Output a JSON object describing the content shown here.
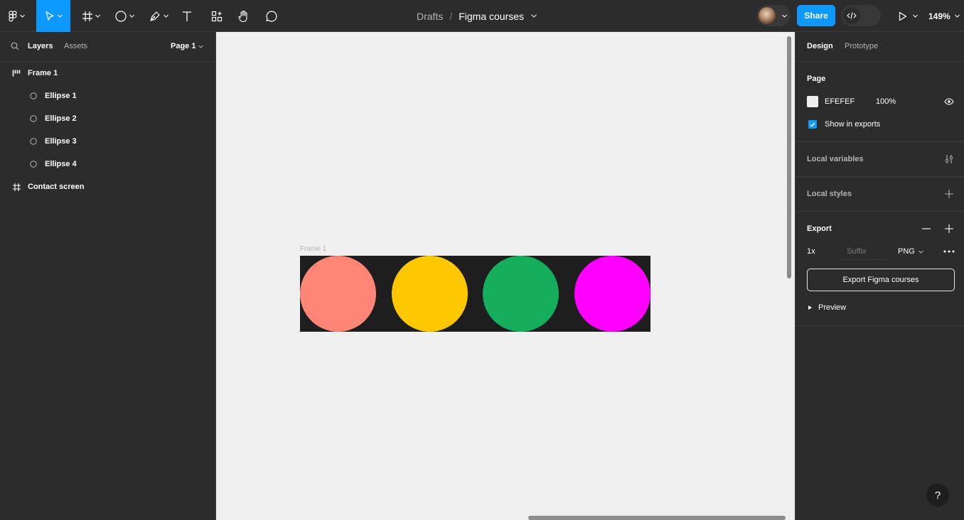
{
  "toolbar": {
    "breadcrumb_root": "Drafts",
    "breadcrumb_sep": "/",
    "file_name": "Figma courses",
    "share_label": "Share",
    "zoom": "149%"
  },
  "left_panel": {
    "tabs": [
      "Layers",
      "Assets"
    ],
    "page_selector": "Page 1",
    "layers": [
      {
        "name": "Frame 1",
        "type": "auto-layout-frame"
      },
      {
        "name": "Ellipse 1",
        "type": "ellipse"
      },
      {
        "name": "Ellipse 2",
        "type": "ellipse"
      },
      {
        "name": "Ellipse 3",
        "type": "ellipse"
      },
      {
        "name": "Ellipse 4",
        "type": "ellipse"
      },
      {
        "name": "Contact screen",
        "type": "frame"
      }
    ]
  },
  "canvas": {
    "background": "#EFEFEF",
    "frame_label": "Frame 1",
    "frame_fill": "#1E1E1E",
    "ellipse_colors": [
      "#FF8577",
      "#FFC700",
      "#14AE5C",
      "#FF00FF"
    ]
  },
  "right_panel": {
    "tabs": [
      "Design",
      "Prototype"
    ],
    "page": {
      "title": "Page",
      "color_hex": "EFEFEF",
      "opacity": "100%",
      "show_in_exports": "Show in exports"
    },
    "local_variables": "Local variables",
    "local_styles": "Local styles",
    "export": {
      "title": "Export",
      "scale": "1x",
      "suffix_placeholder": "Suffix",
      "format": "PNG",
      "button": "Export Figma courses",
      "preview": "Preview"
    }
  },
  "help_label": "?"
}
